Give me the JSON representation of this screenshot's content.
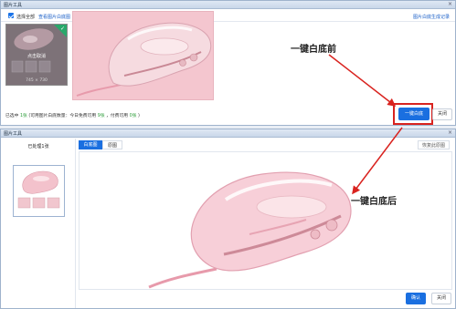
{
  "top_dialog": {
    "title": "图片工具",
    "close_glyph": "×",
    "toolbar": {
      "select_all_label": "选择全部",
      "view_original_label": "查看图片白底图",
      "generate_record_label": "图片白底生成记录"
    },
    "thumbnail": {
      "overlay_label": "点击取消",
      "dimensions": "745 × 730",
      "checkmark": "✓"
    },
    "status": {
      "prefix": "已选中",
      "selected_count": "1张",
      "mid1": "(可用图片白底数量：今日免费可用",
      "free_count": "9张",
      "mid2": "，付费可用",
      "paid_count": "0张",
      "suffix": ")"
    },
    "oneclick_button_label": "一键白底",
    "close_button_label": "关闭"
  },
  "annotations": {
    "before_label": "一键白底前",
    "after_label": "一键白底后"
  },
  "bottom_dialog": {
    "title": "图片工具",
    "close_glyph": "×",
    "processed_label": "已处理1张",
    "tabs": [
      {
        "label": "白底图",
        "active": true
      },
      {
        "label": "原图",
        "active": false
      }
    ],
    "restore_label": "恢复此原图",
    "confirm_button_label": "确认",
    "cancel_button_label": "关闭"
  },
  "colors": {
    "accent_blue": "#1a6fe0",
    "highlight_red": "#d9231f",
    "pink_background": "#f4c6cf",
    "status_green": "#2e9e3b"
  }
}
